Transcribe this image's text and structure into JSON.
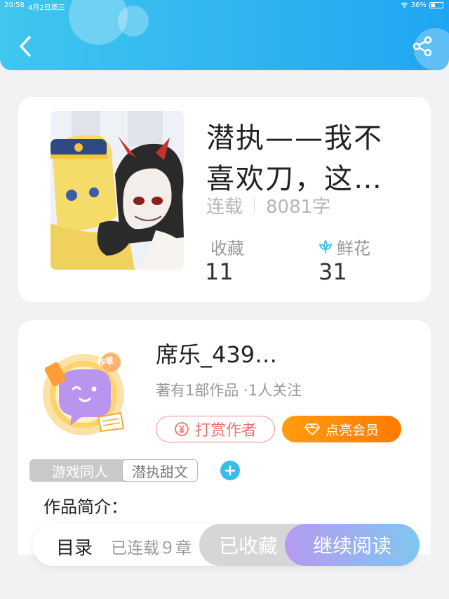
{
  "status_bar": {
    "time": "20:58",
    "date": "4月2日周三",
    "battery": "36%",
    "battery_level": 0.36
  },
  "header": {
    "back_icon": "chevron-left-icon",
    "share_icon": "share-icon"
  },
  "book": {
    "title": "潜执——我不喜欢刀，这…",
    "status": "连载",
    "word_count": "8081字",
    "favorites_label": "收藏",
    "favorites_value": "11",
    "flowers_label": "鲜花",
    "flowers_value": "31",
    "flower_icon": "flower-icon"
  },
  "author": {
    "name": "席乐_439…",
    "sub": "著有1部作品 ·1人关注",
    "avatar_badge": "作者",
    "tip_button": "打赏作者",
    "vip_button": "点亮会员",
    "tags": [
      "游戏同人",
      "潜执甜文"
    ],
    "add_tag": "+",
    "intro_label": "作品简介："
  },
  "bottom_bar": {
    "toc_label": "目录",
    "toc_sub": "已连载９章",
    "collected_button": "已收藏",
    "read_button": "继续阅读"
  },
  "colors": {
    "header": "#2fb4f0",
    "accent_orange": "#ff8a00",
    "tip_red": "#ef6f6f",
    "tag_blue": "#39bcec"
  }
}
